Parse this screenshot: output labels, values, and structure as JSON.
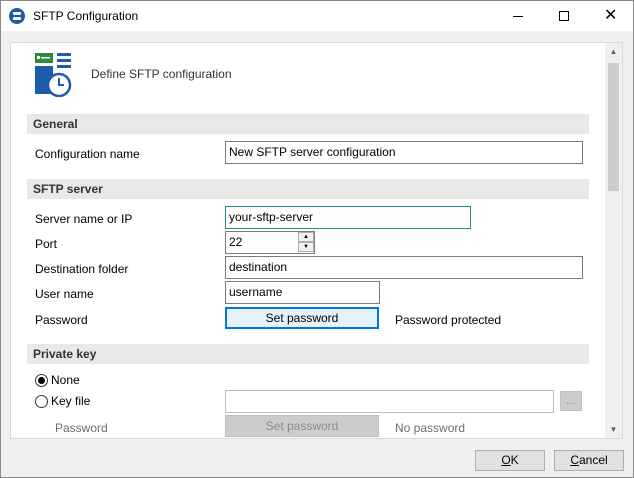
{
  "window": {
    "title": "SFTP Configuration",
    "minimize": "—",
    "maximize": "☐",
    "close": "✕"
  },
  "header": {
    "text": "Define SFTP configuration",
    "icon": "sftp-config-icon"
  },
  "general": {
    "title": "General",
    "config_name_label": "Configuration name",
    "config_name_value": "New SFTP server configuration"
  },
  "server": {
    "title": "SFTP server",
    "server_label": "Server name or IP",
    "server_value": "your-sftp-server",
    "port_label": "Port",
    "port_value": "22",
    "dest_label": "Destination folder",
    "dest_value": "destination",
    "user_label": "User name",
    "user_value": "username",
    "password_label": "Password",
    "set_password": "Set password",
    "password_status": "Password protected"
  },
  "private_key": {
    "title": "Private key",
    "none_label": "None",
    "keyfile_label": "Key file",
    "keyfile_value": "",
    "browse": "...",
    "password_label": "Password",
    "set_password": "Set password",
    "password_status": "No password"
  },
  "footer": {
    "ok_underlined": "O",
    "ok_rest": "K",
    "cancel_underlined": "C",
    "cancel_rest": "ancel"
  }
}
